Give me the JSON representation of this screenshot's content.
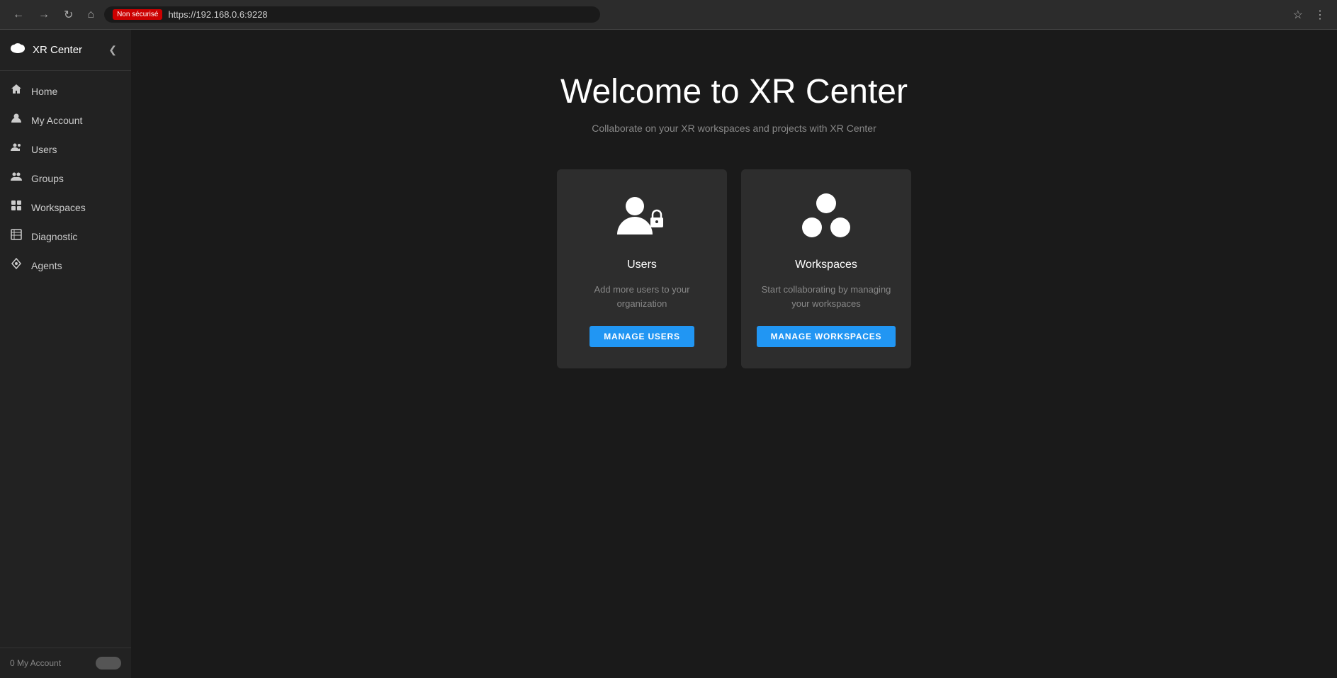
{
  "browser": {
    "not_secure_label": "Non sécurisé",
    "address": "https://192.168.0.6:9228",
    "star_icon": "☆",
    "back_icon": "←",
    "forward_icon": "→",
    "refresh_icon": "↻",
    "home_icon": "⌂"
  },
  "sidebar": {
    "logo_text": "XR Center",
    "collapse_icon": "❮",
    "items": [
      {
        "id": "home",
        "label": "Home",
        "icon": "⌂"
      },
      {
        "id": "my-account",
        "label": "My Account",
        "icon": "○"
      },
      {
        "id": "users",
        "label": "Users",
        "icon": "◉"
      },
      {
        "id": "groups",
        "label": "Groups",
        "icon": "◉"
      },
      {
        "id": "workspaces",
        "label": "Workspaces",
        "icon": "▦"
      },
      {
        "id": "diagnostic",
        "label": "Diagnostic",
        "icon": "▤"
      },
      {
        "id": "agents",
        "label": "Agents",
        "icon": "◇"
      }
    ],
    "footer_label": "0 My Account"
  },
  "main": {
    "welcome_title": "Welcome to XR Center",
    "welcome_subtitle": "Collaborate on your XR workspaces and projects with XR Center",
    "cards": [
      {
        "id": "users-card",
        "title": "Users",
        "description": "Add more users to your organization",
        "button_label": "MANAGE USERS"
      },
      {
        "id": "workspaces-card",
        "title": "Workspaces",
        "description": "Start collaborating by managing your workspaces",
        "button_label": "MANAGE WORKSPACES"
      }
    ]
  },
  "colors": {
    "accent_blue": "#2196f3",
    "sidebar_bg": "#222222",
    "card_bg": "#2d2d2d",
    "main_bg": "#1a1a1a"
  }
}
